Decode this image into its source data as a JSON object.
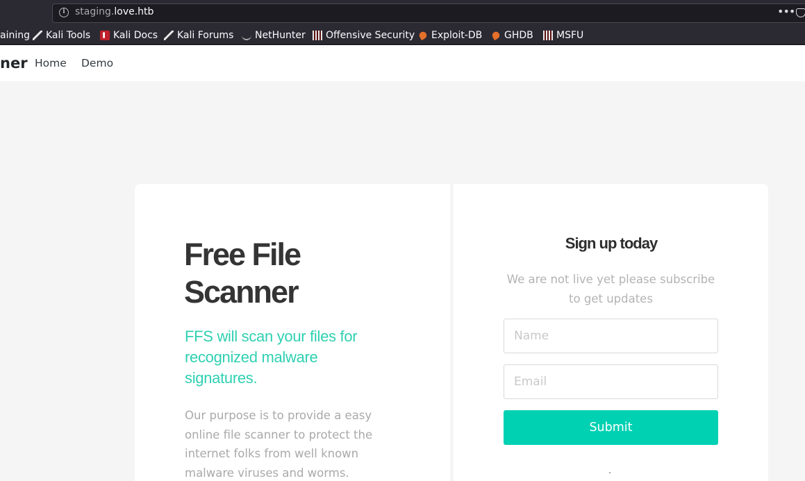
{
  "browser": {
    "url_prefix": "staging.",
    "url_host": "love.htb",
    "menu_icon": "ellipsis-icon",
    "bookmarks": [
      {
        "label": "aining",
        "icon": "none"
      },
      {
        "label": "Kali Tools",
        "icon": "kali-dragon-icon"
      },
      {
        "label": "Kali Docs",
        "icon": "kali-docs-icon"
      },
      {
        "label": "Kali Forums",
        "icon": "kali-dragon-icon"
      },
      {
        "label": "NetHunter",
        "icon": "nethunter-icon"
      },
      {
        "label": "Offensive Security",
        "icon": "offsec-icon"
      },
      {
        "label": "Exploit-DB",
        "icon": "exploit-db-icon"
      },
      {
        "label": "GHDB",
        "icon": "exploit-db-icon"
      },
      {
        "label": "MSFU",
        "icon": "offsec-icon"
      }
    ]
  },
  "site_nav": {
    "brand": "ner",
    "links": [
      "Home",
      "Demo"
    ]
  },
  "hero": {
    "title_line1": "Free File",
    "title_line2": "Scanner",
    "subtitle": "FFS will scan your files for recognized malware signatures.",
    "body": "Our purpose is to provide a easy online file scanner to protect the internet folks from well known malware viruses and worms."
  },
  "signup": {
    "title": "Sign up today",
    "text": "We are not live yet please subscribe to get updates",
    "name_placeholder": "Name",
    "email_placeholder": "Email",
    "submit_label": "Submit"
  },
  "colors": {
    "accent": "#00d1b2",
    "subtitle": "#2fd0b2",
    "page_bg": "#f5f5f5",
    "chrome_bg": "#2b2a33"
  }
}
